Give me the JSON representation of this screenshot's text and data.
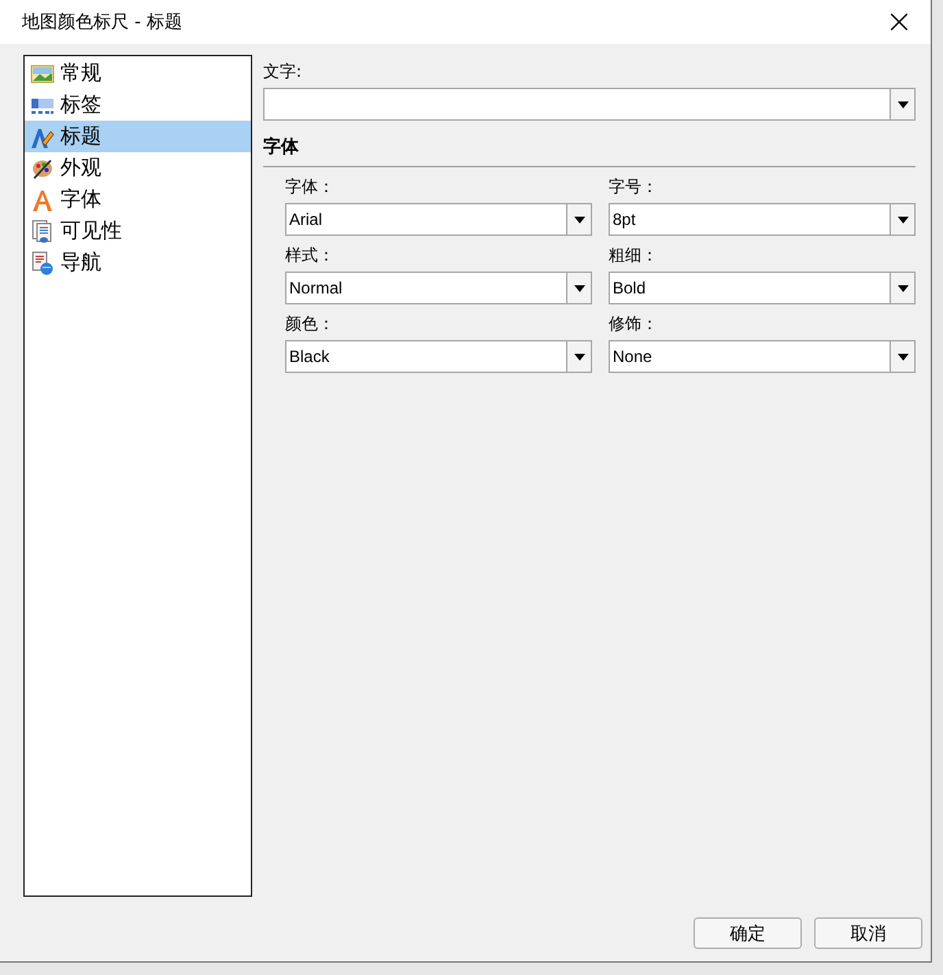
{
  "window": {
    "title": "地图颜色标尺 - 标题"
  },
  "nav": [
    {
      "label": "常规",
      "kind": "picture",
      "selected": false
    },
    {
      "label": "标签",
      "kind": "label",
      "selected": false
    },
    {
      "label": "标题",
      "kind": "title",
      "selected": true
    },
    {
      "label": "外观",
      "kind": "palette",
      "selected": false
    },
    {
      "label": "字体",
      "kind": "font",
      "selected": false
    },
    {
      "label": "可见性",
      "kind": "visibility",
      "selected": false
    },
    {
      "label": "导航",
      "kind": "navigation",
      "selected": false
    }
  ],
  "text_field": {
    "label": "文字:"
  },
  "section": {
    "title": "字体"
  },
  "fields": [
    {
      "label": "字体：",
      "value": "Arial"
    },
    {
      "label": "字号：",
      "value": "8pt"
    },
    {
      "label": "样式：",
      "value": "Normal"
    },
    {
      "label": "粗细：",
      "value": "Bold"
    },
    {
      "label": "颜色：",
      "value": "Black"
    },
    {
      "label": "修饰：",
      "value": "None"
    }
  ],
  "buttons": [
    "确定",
    "取消"
  ]
}
